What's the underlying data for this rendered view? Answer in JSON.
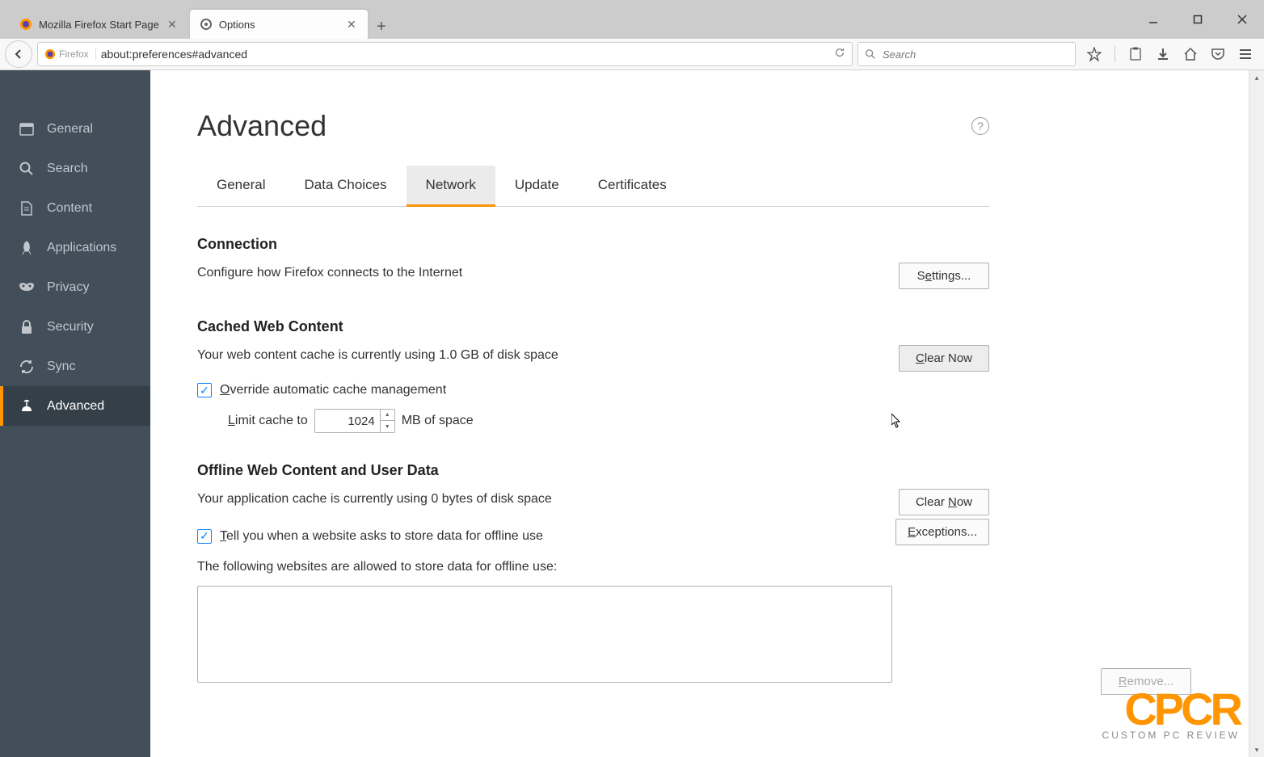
{
  "window": {
    "tabs": [
      {
        "label": "Mozilla Firefox Start Page",
        "icon": "firefox"
      },
      {
        "label": "Options",
        "icon": "gear"
      }
    ],
    "controls": [
      "minimize",
      "maximize",
      "close"
    ]
  },
  "navbar": {
    "identity_label": "Firefox",
    "url": "about:preferences#advanced",
    "search_placeholder": "Search"
  },
  "sidebar": {
    "items": [
      {
        "label": "General",
        "icon": "panel-icon",
        "name": "sidebar-item-general"
      },
      {
        "label": "Search",
        "icon": "search-icon",
        "name": "sidebar-item-search"
      },
      {
        "label": "Content",
        "icon": "document-icon",
        "name": "sidebar-item-content"
      },
      {
        "label": "Applications",
        "icon": "rocket-icon",
        "name": "sidebar-item-applications"
      },
      {
        "label": "Privacy",
        "icon": "mask-icon",
        "name": "sidebar-item-privacy"
      },
      {
        "label": "Security",
        "icon": "lock-icon",
        "name": "sidebar-item-security"
      },
      {
        "label": "Sync",
        "icon": "sync-icon",
        "name": "sidebar-item-sync"
      },
      {
        "label": "Advanced",
        "icon": "wizard-icon",
        "name": "sidebar-item-advanced"
      }
    ],
    "active_index": 7
  },
  "page": {
    "title": "Advanced",
    "subtabs": [
      "General",
      "Data Choices",
      "Network",
      "Update",
      "Certificates"
    ],
    "active_subtab": 2
  },
  "connection": {
    "title": "Connection",
    "desc": "Configure how Firefox connects to the Internet",
    "button": "Settings..."
  },
  "cache": {
    "title": "Cached Web Content",
    "desc": "Your web content cache is currently using 1.0 GB of disk space",
    "clear_button": "Clear Now",
    "override_label": "Override automatic cache management",
    "override_checked": true,
    "limit_prefix": "Limit cache to",
    "limit_value": "1024",
    "limit_suffix": "MB of space"
  },
  "offline": {
    "title": "Offline Web Content and User Data",
    "desc": "Your application cache is currently using 0 bytes of disk space",
    "clear_button": "Clear Now",
    "tell_label": "Tell you when a website asks to store data for offline use",
    "tell_checked": true,
    "exceptions_button": "Exceptions...",
    "allowed_label": "The following websites are allowed to store data for offline use:",
    "remove_button": "Remove..."
  },
  "watermark": {
    "big": "CPCR",
    "small": "CUSTOM PC REVIEW"
  }
}
